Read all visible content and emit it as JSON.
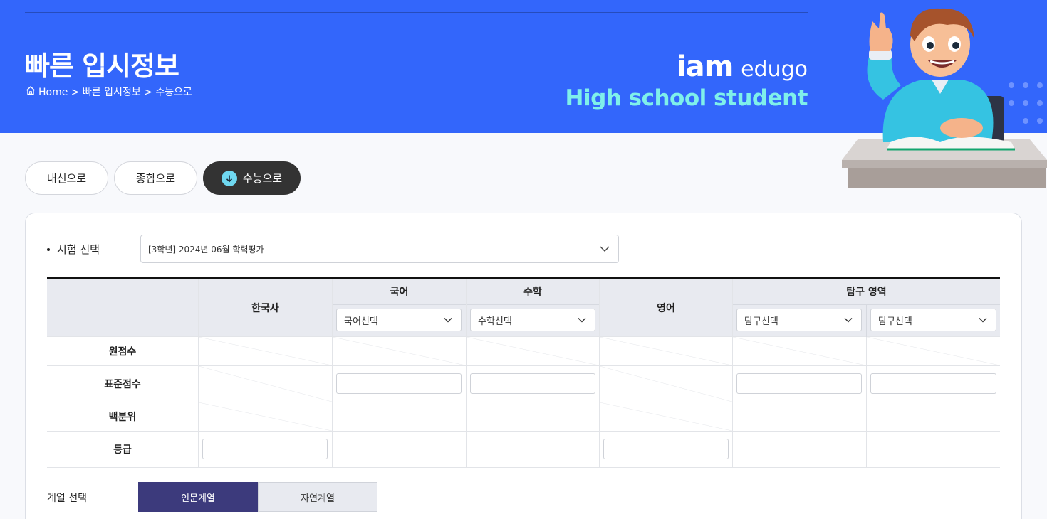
{
  "header": {
    "title": "빠른 입시정보",
    "breadcrumb": "Home > 빠른 입시정보 > 수능으로",
    "brand_bold": "iam",
    "brand_light": "edugo",
    "brand_sub": "High school student"
  },
  "tabs": [
    {
      "label": "내신으로"
    },
    {
      "label": "종합으로"
    },
    {
      "label": "수능으로"
    }
  ],
  "exam": {
    "label": "시험 선택",
    "selected": "[3학년] 2024년 06월 학력평가"
  },
  "table": {
    "headers": {
      "korean_history": "한국사",
      "korean": "국어",
      "math": "수학",
      "english": "영어",
      "inquiry": "탐구 영역"
    },
    "dropdowns": {
      "korean": "국어선택",
      "math": "수학선택",
      "inquiry1": "탐구선택",
      "inquiry2": "탐구선택"
    },
    "rows": [
      "원점수",
      "표준점수",
      "백분위",
      "등급"
    ]
  },
  "track": {
    "label": "계열 선택",
    "options": [
      "인문계열",
      "자연계열"
    ]
  },
  "colors": {
    "banner": "#3366fb",
    "brand_sub": "#7ff0ea",
    "active_tab": "#333333",
    "track_active": "#3c3a7c"
  }
}
